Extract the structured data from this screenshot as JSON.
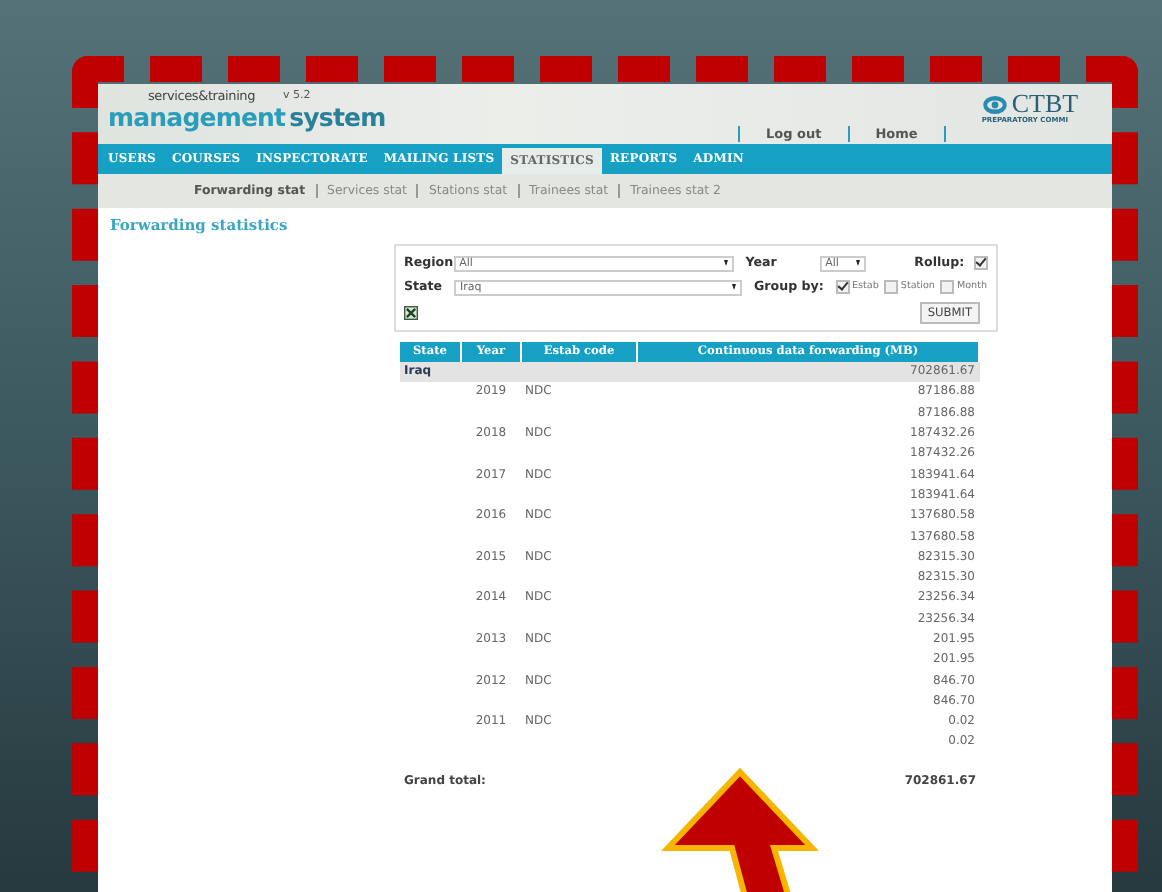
{
  "header": {
    "logo_small": "services&training",
    "version": "v 5.2",
    "logo_main": "management",
    "logo_second": "system",
    "org_name": "CTBT",
    "org_sub": "PREPARATORY COMMI",
    "links": [
      "Log out",
      "Home"
    ]
  },
  "nav": [
    {
      "label": "USERS",
      "selected": false
    },
    {
      "label": "COURSES",
      "selected": false
    },
    {
      "label": "INSPECTORATE",
      "selected": false
    },
    {
      "label": "MAILING LISTS",
      "selected": false
    },
    {
      "label": "STATISTICS",
      "selected": true
    },
    {
      "label": "REPORTS",
      "selected": false
    },
    {
      "label": "ADMIN",
      "selected": false
    }
  ],
  "subnav": [
    {
      "label": "Forwarding stat",
      "selected": true
    },
    {
      "label": "Services stat",
      "selected": false
    },
    {
      "label": "Stations stat",
      "selected": false
    },
    {
      "label": "Trainees stat",
      "selected": false
    },
    {
      "label": "Trainees stat 2",
      "selected": false
    }
  ],
  "title": "Forwarding statistics",
  "filters": {
    "region_label": "Region",
    "region_value": "All",
    "state_label": "State",
    "state_value": "Iraq",
    "year_label": "Year",
    "year_value": "All",
    "rollup_label": "Rollup:",
    "rollup_checked": true,
    "group_label": "Group by:",
    "group_options": [
      {
        "label": "Estab",
        "checked": true
      },
      {
        "label": "Station",
        "checked": false
      },
      {
        "label": "Month",
        "checked": false
      }
    ],
    "submit": "SUBMIT"
  },
  "table": {
    "columns": [
      "State",
      "Year",
      "Estab code",
      "Continuous data forwarding (MB)"
    ],
    "rows": [
      {
        "kind": "state",
        "state": "Iraq",
        "value": "702861.67"
      },
      {
        "kind": "detail",
        "year": "2019",
        "code": "NDC",
        "value": "87186.88"
      },
      {
        "kind": "subtotal",
        "value": "87186.88"
      },
      {
        "kind": "detail",
        "year": "2018",
        "code": "NDC",
        "value": "187432.26"
      },
      {
        "kind": "subtotal",
        "value": "187432.26"
      },
      {
        "kind": "detail",
        "year": "2017",
        "code": "NDC",
        "value": "183941.64"
      },
      {
        "kind": "subtotal",
        "value": "183941.64"
      },
      {
        "kind": "detail",
        "year": "2016",
        "code": "NDC",
        "value": "137680.58"
      },
      {
        "kind": "subtotal",
        "value": "137680.58"
      },
      {
        "kind": "detail",
        "year": "2015",
        "code": "NDC",
        "value": "82315.30"
      },
      {
        "kind": "subtotal",
        "value": "82315.30"
      },
      {
        "kind": "detail",
        "year": "2014",
        "code": "NDC",
        "value": "23256.34"
      },
      {
        "kind": "subtotal",
        "value": "23256.34"
      },
      {
        "kind": "detail",
        "year": "2013",
        "code": "NDC",
        "value": "201.95"
      },
      {
        "kind": "subtotal",
        "value": "201.95"
      },
      {
        "kind": "detail",
        "year": "2012",
        "code": "NDC",
        "value": "846.70"
      },
      {
        "kind": "subtotal",
        "value": "846.70"
      },
      {
        "kind": "detail",
        "year": "2011",
        "code": "NDC",
        "value": "0.02"
      },
      {
        "kind": "subtotal",
        "value": "0.02"
      }
    ],
    "total_label": "Grand total:",
    "total_value": "702861.67"
  }
}
